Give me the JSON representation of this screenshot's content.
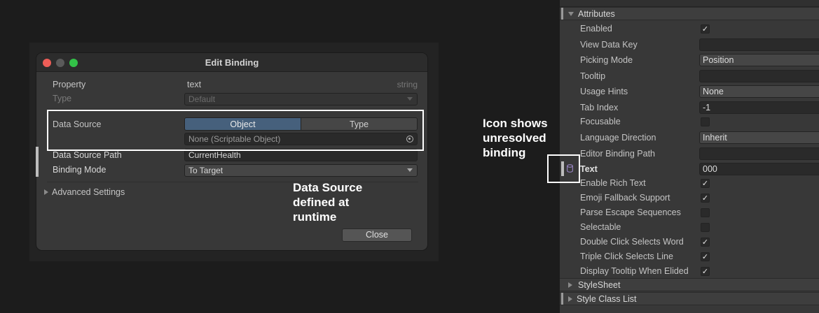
{
  "dialog": {
    "title": "Edit Binding",
    "property_label": "Property",
    "property_value": "text",
    "property_type": "string",
    "type_label": "Type",
    "type_value": "Default",
    "data_source_label": "Data Source",
    "data_source_tabs": [
      "Object",
      "Type"
    ],
    "data_source_field": "None (Scriptable Object)",
    "data_source_path_label": "Data Source Path",
    "data_source_path_value": "CurrentHealth",
    "binding_mode_label": "Binding Mode",
    "binding_mode_value": "To Target",
    "advanced_settings": "Advanced Settings",
    "close_label": "Close"
  },
  "annotations": {
    "runtime_note": [
      "Data Source",
      "defined at",
      "runtime"
    ],
    "icon_note": [
      "Icon shows",
      "unresolved",
      "binding"
    ]
  },
  "inspector": {
    "attributes_title": "Attributes",
    "rows": [
      {
        "label": "Enabled",
        "kind": "check",
        "checked": true
      },
      {
        "label": "View Data Key",
        "kind": "text",
        "value": ""
      },
      {
        "label": "Picking Mode",
        "kind": "dropdown",
        "value": "Position"
      },
      {
        "label": "Tooltip",
        "kind": "text",
        "value": ""
      },
      {
        "label": "Usage Hints",
        "kind": "dropdown",
        "value": "None"
      },
      {
        "label": "Tab Index",
        "kind": "text",
        "value": "-1"
      },
      {
        "label": "Focusable",
        "kind": "check",
        "checked": false
      },
      {
        "label": "Language Direction",
        "kind": "dropdown",
        "value": "Inherit"
      },
      {
        "label": "Editor Binding Path",
        "kind": "text",
        "value": ""
      },
      {
        "label": "Text",
        "kind": "text",
        "value": "000",
        "bold": true
      },
      {
        "label": "Enable Rich Text",
        "kind": "check",
        "checked": true
      },
      {
        "label": "Emoji Fallback Support",
        "kind": "check",
        "checked": true
      },
      {
        "label": "Parse Escape Sequences",
        "kind": "check",
        "checked": false
      },
      {
        "label": "Selectable",
        "kind": "check",
        "checked": false
      },
      {
        "label": "Double Click Selects Word",
        "kind": "check",
        "checked": true
      },
      {
        "label": "Triple Click Selects Line",
        "kind": "check",
        "checked": true
      },
      {
        "label": "Display Tooltip When Elided",
        "kind": "check",
        "checked": true
      }
    ],
    "stylesheet_title": "StyleSheet",
    "style_class_list_title": "Style Class List",
    "check_glyph": "✓"
  },
  "colors": {
    "accent_tab": "#46607c",
    "annotation": "#ffffff",
    "bind_icon": "#a58fd6"
  },
  "icons": {
    "bind_icon": "database-icon",
    "target": "object-picker-icon"
  }
}
